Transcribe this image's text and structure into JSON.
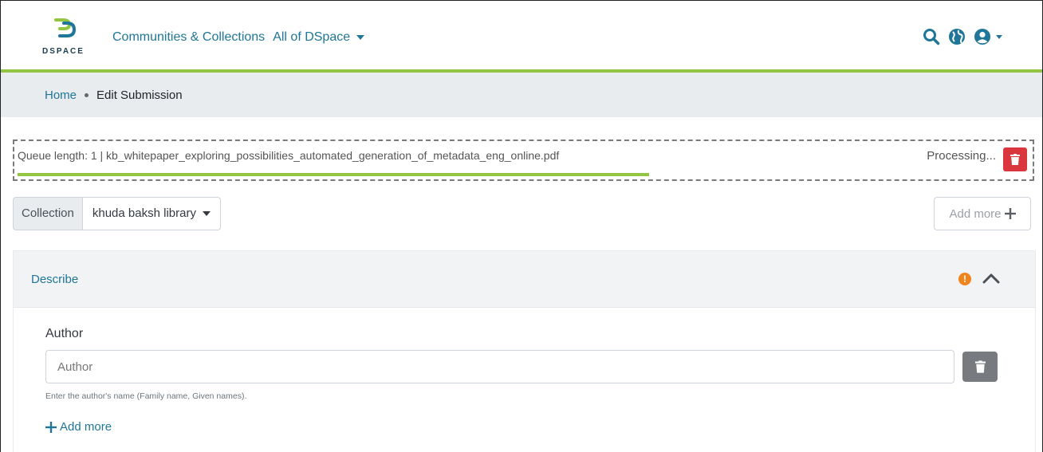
{
  "brand": {
    "logo_text": "DSPACE",
    "accent_color": "#92c642",
    "link_color": "#207698"
  },
  "nav": {
    "communities_label": "Communities & Collections",
    "browse_label": "All of DSpace"
  },
  "header_icons": [
    "search-icon",
    "globe-icon",
    "user-icon"
  ],
  "breadcrumb": {
    "home": "Home",
    "current": "Edit Submission"
  },
  "upload_queue": {
    "text": "Queue length: 1 | kb_whitepaper_exploring_possibilities_automated_generation_of_metadata_eng_online.pdf",
    "status": "Processing...",
    "progress": 0.62
  },
  "collection": {
    "label": "Collection",
    "selected": "khuda baksh library",
    "add_more_label": "Add more"
  },
  "section": {
    "title": "Describe",
    "status_icon": "warning-icon",
    "toggle_icon": "chevron-up-icon"
  },
  "author_field": {
    "label": "Author",
    "placeholder": "Author",
    "value": "",
    "help_text": "Enter the author's name (Family name, Given names).",
    "add_more_label": "Add more"
  }
}
